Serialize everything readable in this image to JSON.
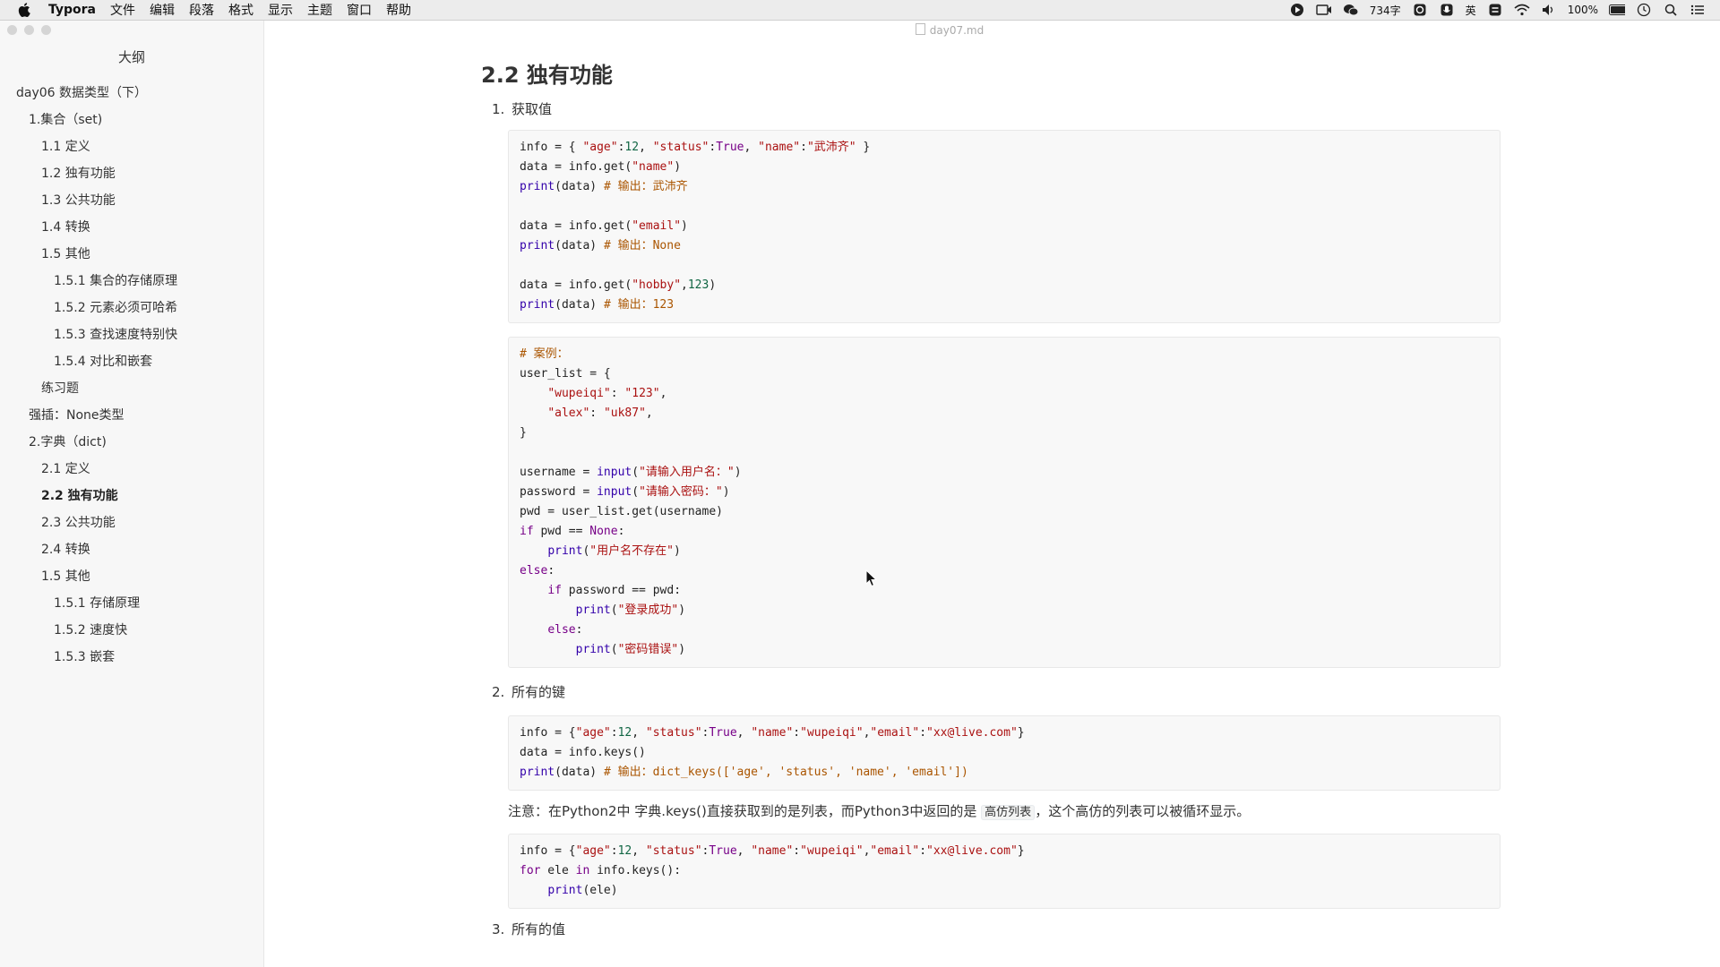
{
  "menubar": {
    "app_name": "Typora",
    "menus": [
      "文件",
      "编辑",
      "段落",
      "格式",
      "显示",
      "主题",
      "窗口",
      "帮助"
    ],
    "word_count": "734字",
    "battery": "100%",
    "ime": "英"
  },
  "sidebar": {
    "title": "大纲",
    "items": [
      {
        "label": "day06 数据类型（下）",
        "level": 1
      },
      {
        "label": "1.集合（set)",
        "level": 2
      },
      {
        "label": "1.1 定义",
        "level": 3
      },
      {
        "label": "1.2 独有功能",
        "level": 3
      },
      {
        "label": "1.3 公共功能",
        "level": 3
      },
      {
        "label": "1.4 转换",
        "level": 3
      },
      {
        "label": "1.5 其他",
        "level": 3
      },
      {
        "label": "1.5.1 集合的存储原理",
        "level": 4
      },
      {
        "label": "1.5.2 元素必须可哈希",
        "level": 4
      },
      {
        "label": "1.5.3 查找速度特别快",
        "level": 4
      },
      {
        "label": "1.5.4 对比和嵌套",
        "level": 4
      },
      {
        "label": "练习题",
        "level": 3
      },
      {
        "label": "强插：None类型",
        "level": 2
      },
      {
        "label": "2.字典（dict)",
        "level": 2
      },
      {
        "label": "2.1 定义",
        "level": 3
      },
      {
        "label": "2.2 独有功能",
        "level": 3,
        "active": true
      },
      {
        "label": "2.3 公共功能",
        "level": 3
      },
      {
        "label": "2.4 转换",
        "level": 3
      },
      {
        "label": "1.5 其他",
        "level": 3
      },
      {
        "label": "1.5.1 存储原理",
        "level": 4
      },
      {
        "label": "1.5.2 速度快",
        "level": 4
      },
      {
        "label": "1.5.3 嵌套",
        "level": 4
      }
    ]
  },
  "document": {
    "filename": "day07.md",
    "heading": "2.2 独有功能",
    "list": [
      {
        "num": "1.",
        "label": "获取值"
      },
      {
        "num": "2.",
        "label": "所有的键"
      },
      {
        "num": "3.",
        "label": "所有的值"
      }
    ],
    "code_blocks": [
      [
        "info = { \"age\":12, \"status\":True, \"name\":\"武沛齐\" }",
        "data = info.get(\"name\")",
        "print(data) # 输出：武沛齐",
        "",
        "data = info.get(\"email\")",
        "print(data) # 输出：None",
        "",
        "data = info.get(\"hobby\",123)",
        "print(data) # 输出：123"
      ],
      [
        "# 案例：",
        "user_list = {",
        "    \"wupeiqi\": \"123\",",
        "    \"alex\": \"uk87\",",
        "}",
        "",
        "username = input(\"请输入用户名：\")",
        "password = input(\"请输入密码：\")",
        "pwd = user_list.get(username)",
        "if pwd == None:",
        "    print(\"用户名不存在\")",
        "else:",
        "    if password == pwd:",
        "        print(\"登录成功\")",
        "    else:",
        "        print(\"密码错误\")"
      ],
      [
        "info = {\"age\":12, \"status\":True, \"name\":\"wupeiqi\",\"email\":\"xx@live.com\"}",
        "data = info.keys()",
        "print(data) # 输出：dict_keys(['age', 'status', 'name', 'email'])"
      ],
      [
        "info = {\"age\":12, \"status\":True, \"name\":\"wupeiqi\",\"email\":\"xx@live.com\"}",
        "for ele in info.keys():",
        "    print(ele)"
      ]
    ],
    "note": {
      "before": "注意：在Python2中 字典.keys()直接获取到的是列表，而Python3中返回的是 ",
      "code": "高仿列表",
      "after": "，这个高仿的列表可以被循环显示。"
    }
  }
}
